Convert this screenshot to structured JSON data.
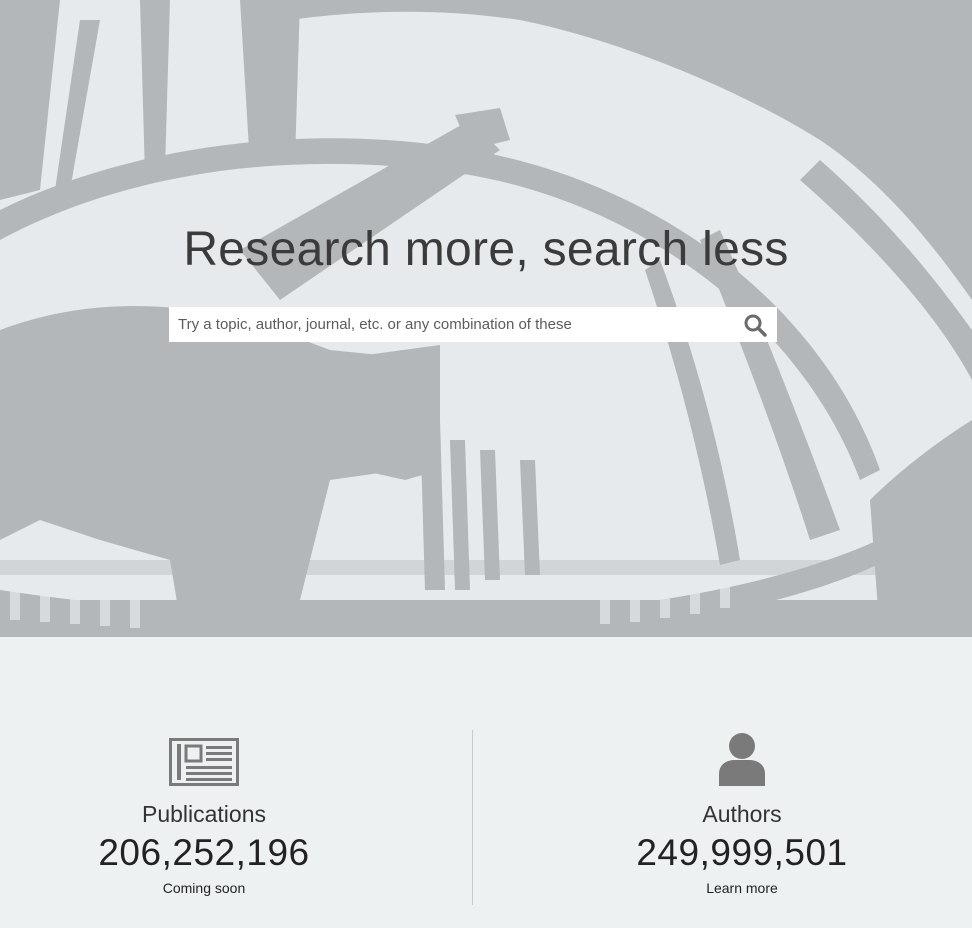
{
  "hero": {
    "headline": "Research more, search less",
    "search": {
      "placeholder": "Try a topic, author, journal, etc. or any combination of these",
      "value": "",
      "button_icon": "search-icon"
    }
  },
  "stats": [
    {
      "icon": "newspaper-icon",
      "label": "Publications",
      "count": "206,252,196",
      "link": "Coming soon"
    },
    {
      "icon": "person-icon",
      "label": "Authors",
      "count": "249,999,501",
      "link": "Learn more"
    }
  ],
  "colors": {
    "hero_bg": "#e6eaed",
    "hero_art": "#b3b7ba",
    "stats_bg": "#eef1f2",
    "icon": "#7a7a7a"
  }
}
